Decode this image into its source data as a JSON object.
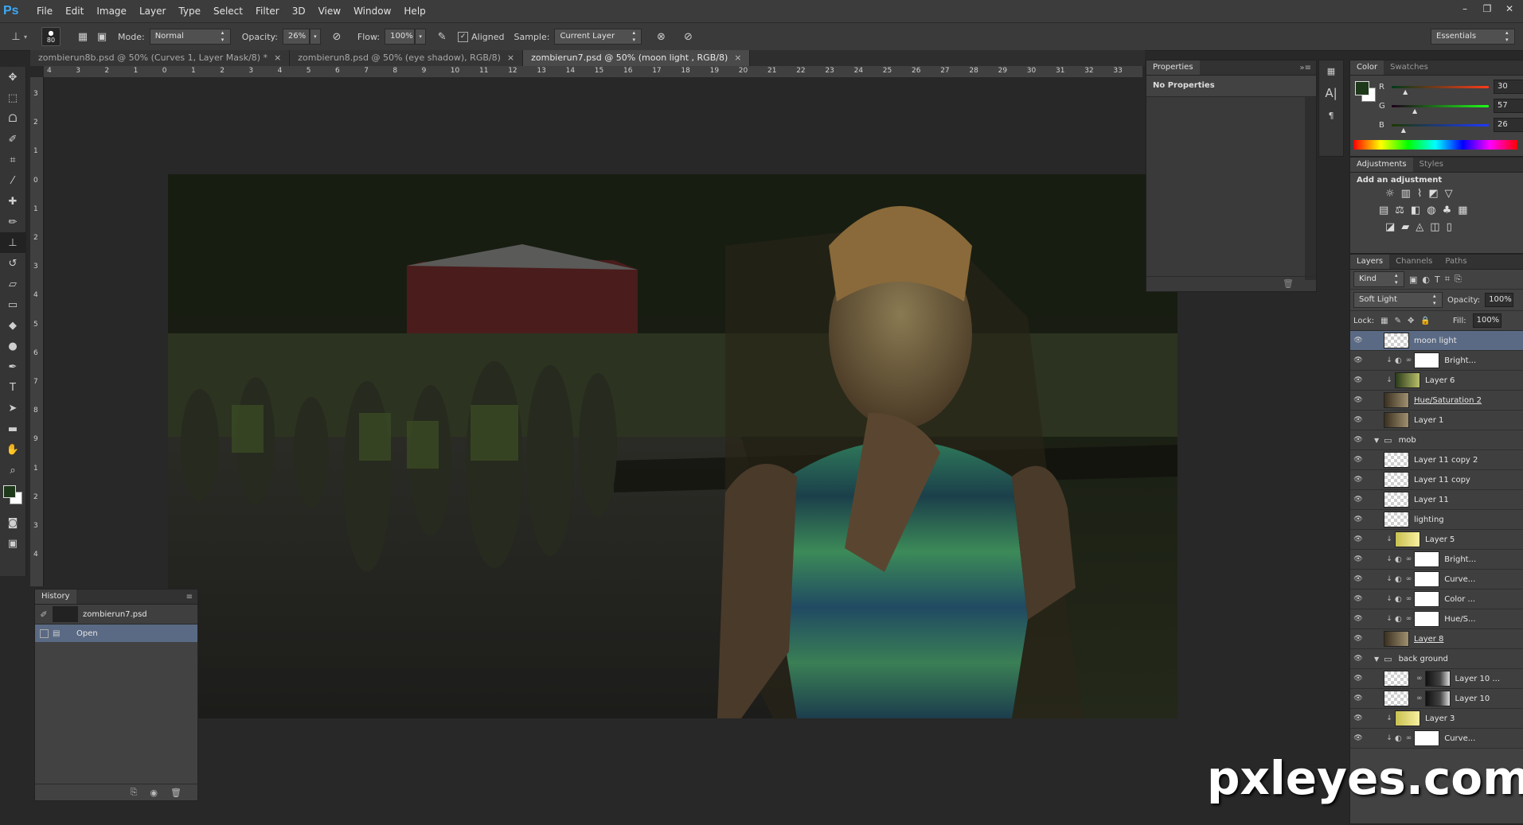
{
  "app": {
    "logo": "Ps",
    "workspace": "Essentials"
  },
  "menu": [
    "File",
    "Edit",
    "Image",
    "Layer",
    "Type",
    "Select",
    "Filter",
    "3D",
    "View",
    "Window",
    "Help"
  ],
  "options": {
    "brush_size": "80",
    "mode_label": "Mode:",
    "mode_value": "Normal",
    "opacity_label": "Opacity:",
    "opacity_value": "26%",
    "flow_label": "Flow:",
    "flow_value": "100%",
    "aligned_label": "Aligned",
    "sample_label": "Sample:",
    "sample_value": "Current Layer"
  },
  "tabs": [
    {
      "label": "zombierun8b.psd @ 50% (Curves 1, Layer Mask/8) *"
    },
    {
      "label": "zombierun8.psd @ 50% (eye shadow), RGB/8)"
    },
    {
      "label": "zombierun7.psd @ 50% (moon light , RGB/8)"
    }
  ],
  "ruler_h": [
    "4",
    "3",
    "2",
    "1",
    "0",
    "1",
    "2",
    "3",
    "4",
    "5",
    "6",
    "7",
    "8",
    "9",
    "10",
    "11",
    "12",
    "13",
    "14",
    "15",
    "16",
    "17",
    "18",
    "19",
    "20",
    "21",
    "22",
    "23",
    "24",
    "25",
    "26",
    "27",
    "28",
    "29",
    "30",
    "31",
    "32",
    "33"
  ],
  "ruler_v": [
    "3",
    "2",
    "1",
    "0",
    "1",
    "2",
    "3",
    "4",
    "5",
    "6",
    "7",
    "8",
    "9",
    "1",
    "2",
    "3",
    "4"
  ],
  "properties": {
    "title": "Properties",
    "empty": "No Properties"
  },
  "history": {
    "title": "History",
    "items": [
      {
        "label": "zombierun7.psd"
      },
      {
        "label": "Open"
      }
    ]
  },
  "color": {
    "tabs": [
      "Color",
      "Swatches"
    ],
    "r_label": "R",
    "g_label": "G",
    "b_label": "B",
    "r": "30",
    "g": "57",
    "b": "26",
    "r_fraction": 0.12,
    "g_fraction": 0.22,
    "b_fraction": 0.1,
    "foreground": "#1e391a"
  },
  "adjustments": {
    "tabs": [
      "Adjustments",
      "Styles"
    ],
    "heading": "Add an adjustment"
  },
  "layers": {
    "tabs": [
      "Layers",
      "Channels",
      "Paths"
    ],
    "kind": "Kind",
    "blend": "Soft Light",
    "opacity_label": "Opacity:",
    "opacity": "100%",
    "lock_label": "Lock:",
    "fill_label": "Fill:",
    "fill": "100%",
    "items": [
      {
        "name": "moon light",
        "type": "checker",
        "active": true
      },
      {
        "name": "Bright...",
        "type": "adj",
        "clip": true
      },
      {
        "name": "Layer 6",
        "type": "dark",
        "clip": true
      },
      {
        "name": "Hue/Saturation 2",
        "type": "photo",
        "underline": true
      },
      {
        "name": "Layer 1",
        "type": "photo"
      },
      {
        "name": "mob",
        "type": "group"
      },
      {
        "name": "Layer 11 copy 2",
        "type": "checker"
      },
      {
        "name": "Layer 11 copy",
        "type": "checker"
      },
      {
        "name": "Layer 11",
        "type": "checker"
      },
      {
        "name": "lighting",
        "type": "checker"
      },
      {
        "name": "Layer 5",
        "type": "yellow",
        "clip": true
      },
      {
        "name": "Bright...",
        "type": "adj",
        "clip": true
      },
      {
        "name": "Curve...",
        "type": "adj",
        "clip": true
      },
      {
        "name": "Color ...",
        "type": "adj",
        "clip": true
      },
      {
        "name": "Hue/S...",
        "type": "adj",
        "clip": true
      },
      {
        "name": "Layer 8",
        "type": "photo",
        "underline": true
      },
      {
        "name": "back ground",
        "type": "group"
      },
      {
        "name": "Layer 10 ...",
        "type": "mask"
      },
      {
        "name": "Layer 10",
        "type": "mask"
      },
      {
        "name": "Layer 3",
        "type": "yellow",
        "clip": true
      },
      {
        "name": "Curve...",
        "type": "adj",
        "clip": true
      }
    ]
  },
  "watermark": "pxleyes.com"
}
